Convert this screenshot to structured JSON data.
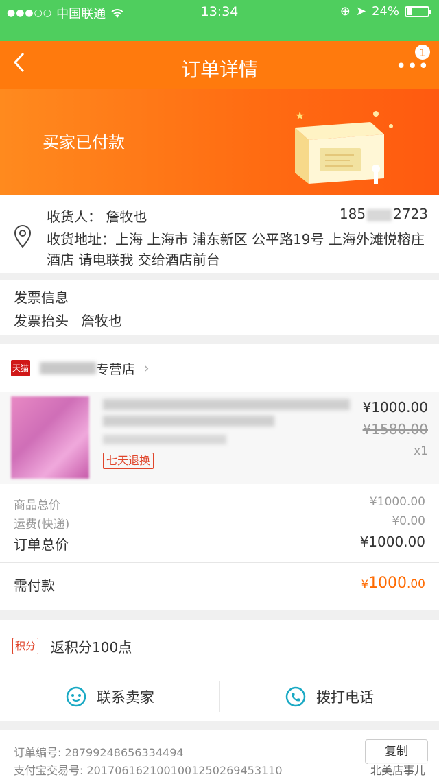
{
  "status_bar": {
    "carrier": "中国联通",
    "time": "13:34",
    "battery": "24%",
    "battery_level": 0.24
  },
  "nav": {
    "title": "订单详情",
    "badge": "1"
  },
  "banner": {
    "status": "买家已付款"
  },
  "address": {
    "recipient_label": "收货人：",
    "recipient": "詹牧也",
    "phone_prefix": "185",
    "phone_suffix": "2723",
    "address_label": "收货地址：",
    "address": "上海 上海市 浦东新区 公平路19号 上海外滩悦榕庄酒店 请电联我 交给酒店前台"
  },
  "invoice": {
    "title": "发票信息",
    "header_label": "发票抬头",
    "header_value": "詹牧也"
  },
  "shop": {
    "platform_badge": "天猫",
    "name_suffix": "专营店",
    "product": {
      "tag": "七天退换",
      "price": "¥1000.00",
      "original_price": "¥1580.00",
      "quantity": "x1"
    },
    "summary": {
      "goods_total_label": "商品总价",
      "goods_total": "¥1000.00",
      "shipping_label": "运费(快递)",
      "shipping": "¥0.00",
      "order_total_label": "订单总价",
      "order_total": "¥1000.00"
    },
    "payment": {
      "label": "需付款",
      "currency": "¥",
      "integer": "1000",
      "decimal": ".00"
    }
  },
  "points": {
    "tag": "积分",
    "prefix": "返积分",
    "value": "100",
    "suffix": "点"
  },
  "actions": {
    "contact_seller": "联系卖家",
    "call": "拨打电话"
  },
  "order_info": {
    "order_no_label": "订单编号:",
    "order_no": "2879924865633449​4",
    "alipay_label": "支付宝交易号:",
    "alipay_no": "2017061621001001250269453110",
    "copy": "复制"
  },
  "watermark": "北美店事儿"
}
